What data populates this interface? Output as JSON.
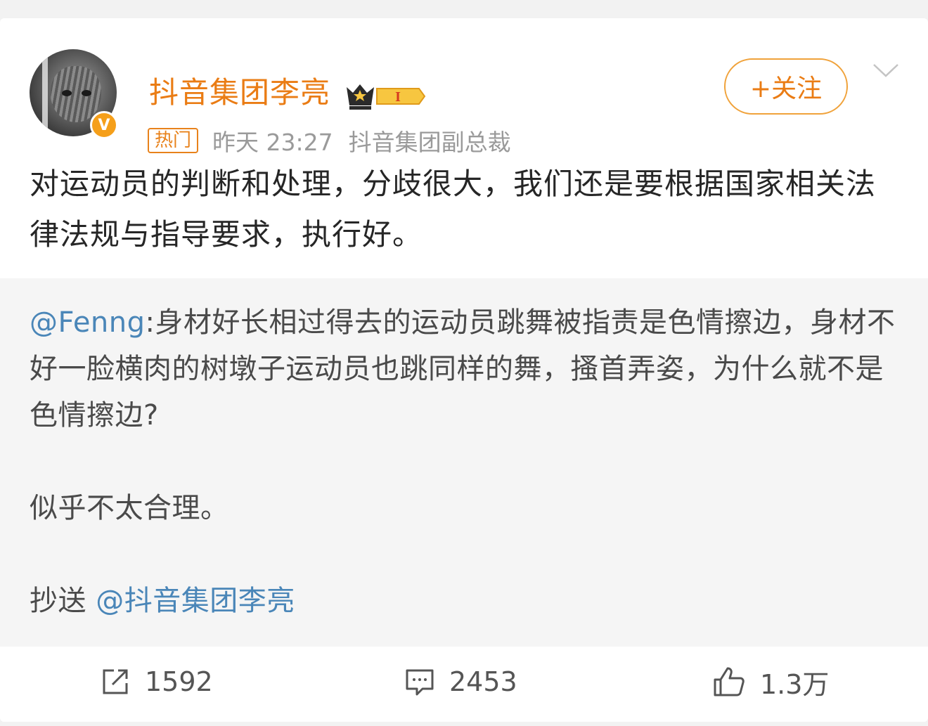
{
  "post": {
    "author": {
      "name": "抖音集团李亮",
      "verified_mark": "V",
      "level_badge": "I",
      "icon": "crown-icon"
    },
    "hot_label": "热门",
    "time": "昨天 23:27",
    "author_title": "抖音集团副总裁",
    "follow_label": "+关注",
    "content": "对运动员的判断和处理，分歧很大，我们还是要根据国家相关法律法规与指导要求，执行好。"
  },
  "repost": {
    "mention": "@Fenng",
    "text": ":身材好长相过得去的运动员跳舞被指责是色情擦边，身材不好一脸横肉的树墩子运动员也跳同样的舞，搔首弄姿，为什么就不是色情擦边?",
    "line2": "似乎不太合理。",
    "cc_label": "抄送 ",
    "cc_mention": "@抖音集团李亮"
  },
  "actions": {
    "share_count": "1592",
    "comment_count": "2453",
    "like_count": "1.3万"
  },
  "colors": {
    "accent": "#ea7c14",
    "link": "#4a86b8",
    "verified": "#f59f1a"
  }
}
